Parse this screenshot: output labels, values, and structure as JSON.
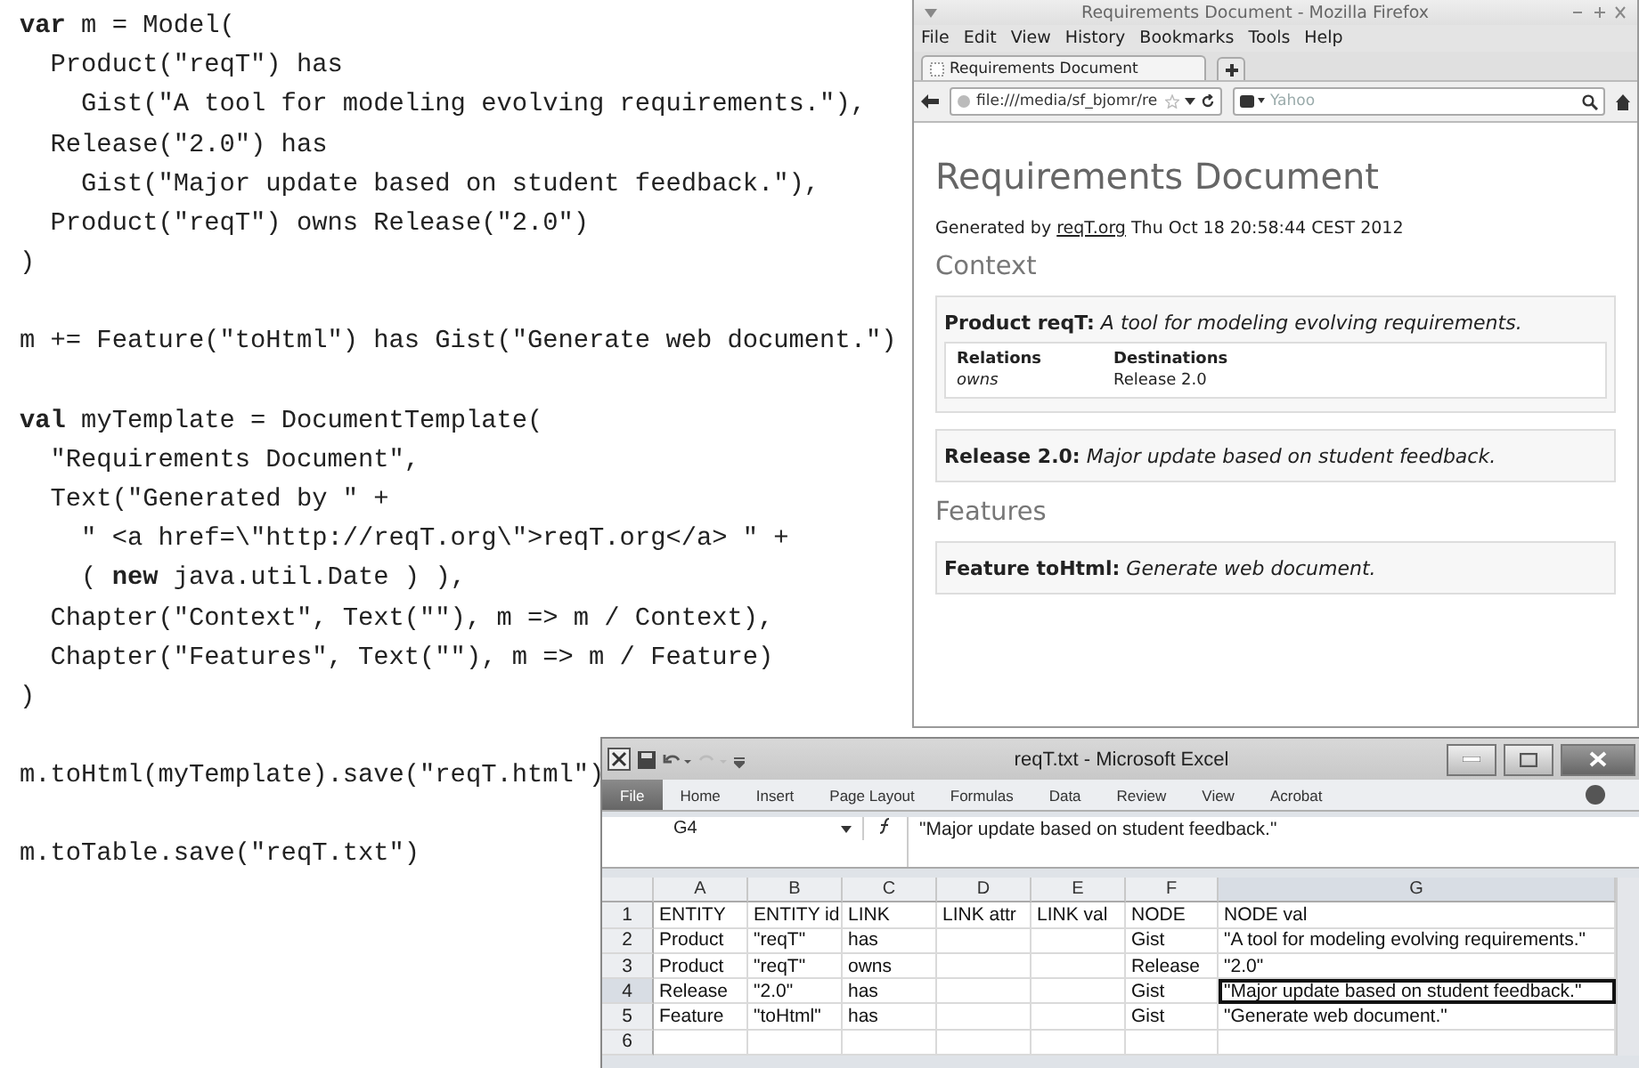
{
  "code": {
    "blocks": [
      [
        "**var** m = Model(",
        "  Product(\"reqT\") has",
        "    Gist(\"A tool for modeling evolving requirements.\"),",
        "  Release(\"2.0\") has",
        "    Gist(\"Major update based on student feedback.\"),",
        "  Product(\"reqT\") owns Release(\"2.0\")",
        ")"
      ],
      [
        "m += Feature(\"toHtml\") has Gist(\"Generate web document.\")"
      ],
      [
        "**val** myTemplate = DocumentTemplate(",
        "  \"Requirements Document\",",
        "  Text(\"Generated by \" +",
        "    \" <a href=\\\"http://reqT.org\\\">reqT.org</a> \" +",
        "    ( **new** java.util.Date ) ),",
        "  Chapter(\"Context\", Text(\"\"), m => m / Context),",
        "  Chapter(\"Features\", Text(\"\"), m => m / Feature)",
        ")"
      ],
      [
        "m.toHtml(myTemplate).save(\"reqT.html\")"
      ],
      [
        "m.toTable.save(\"reqT.txt\")"
      ]
    ]
  },
  "browser": {
    "window": {
      "title": "Requirements Document - Mozilla Firefox"
    },
    "menu": [
      "File",
      "Edit",
      "View",
      "History",
      "Bookmarks",
      "Tools",
      "Help"
    ],
    "tabs": [
      {
        "label": "Requirements Document",
        "selected": true
      }
    ],
    "address": {
      "value": "file:///media/sf_bjomr/re"
    },
    "search": {
      "placeholder": "Yahoo"
    },
    "page": {
      "title": "Requirements Document",
      "generated": {
        "prefix": "Generated by",
        "link": "reqT.org",
        "suffix": "Thu Oct 18 20:58:44 CEST 2012"
      },
      "chapters": [
        {
          "title": "Context",
          "entities": [
            {
              "name": "Product reqT:",
              "gist": "A tool for modeling evolving requirements.",
              "relations": {
                "headers": [
                  "Relations",
                  "Destinations"
                ],
                "rows": [
                  [
                    "owns",
                    "Release 2.0"
                  ]
                ]
              }
            },
            {
              "name": "Release 2.0:",
              "gist": "Major update based on student feedback."
            }
          ]
        },
        {
          "title": "Features",
          "entities": [
            {
              "name": "Feature toHtml:",
              "gist": "Generate web document."
            }
          ]
        }
      ]
    }
  },
  "excel": {
    "window": {
      "title": "reqT.txt  -  Microsoft Excel"
    },
    "ribbon_tabs": [
      {
        "label": "File",
        "selected": true
      },
      {
        "label": "Home",
        "selected": false
      },
      {
        "label": "Insert",
        "selected": false
      },
      {
        "label": "Page Layout",
        "selected": false
      },
      {
        "label": "Formulas",
        "selected": false
      },
      {
        "label": "Data",
        "selected": false
      },
      {
        "label": "Review",
        "selected": false
      },
      {
        "label": "View",
        "selected": false
      },
      {
        "label": "Acrobat",
        "selected": false
      }
    ],
    "name_box": "G4",
    "formula": "\"Major update based on student feedback.\"",
    "columns": [
      {
        "label": "A",
        "selected": false
      },
      {
        "label": "B",
        "selected": false
      },
      {
        "label": "C",
        "selected": false
      },
      {
        "label": "D",
        "selected": false
      },
      {
        "label": "E",
        "selected": false
      },
      {
        "label": "F",
        "selected": false
      },
      {
        "label": "G",
        "selected": true
      }
    ],
    "rows": [
      {
        "number": "1",
        "selected": false,
        "cells": {
          "A": "ENTITY",
          "B": "ENTITY id",
          "C": "LINK",
          "D": "LINK attr",
          "E": "LINK val",
          "F": "NODE",
          "G": "NODE val"
        }
      },
      {
        "number": "2",
        "selected": false,
        "cells": {
          "A": "Product",
          "B": "\"reqT\"",
          "C": "has",
          "F": "Gist",
          "G": "\"A tool for modeling evolving requirements.\""
        }
      },
      {
        "number": "3",
        "selected": false,
        "cells": {
          "A": "Product",
          "B": "\"reqT\"",
          "C": "owns",
          "F": "Release",
          "G": "\"2.0\""
        }
      },
      {
        "number": "4",
        "selected": true,
        "cells": {
          "A": "Release",
          "B": "\"2.0\"",
          "C": "has",
          "F": "Gist",
          "G": "\"Major update based on student feedback.\""
        }
      },
      {
        "number": "5",
        "selected": false,
        "cells": {
          "A": "Feature",
          "B": "\"toHtml\"",
          "C": "has",
          "F": "Gist",
          "G": "\"Generate web document.\""
        }
      },
      {
        "number": "6",
        "selected": false,
        "cells": {}
      }
    ]
  }
}
